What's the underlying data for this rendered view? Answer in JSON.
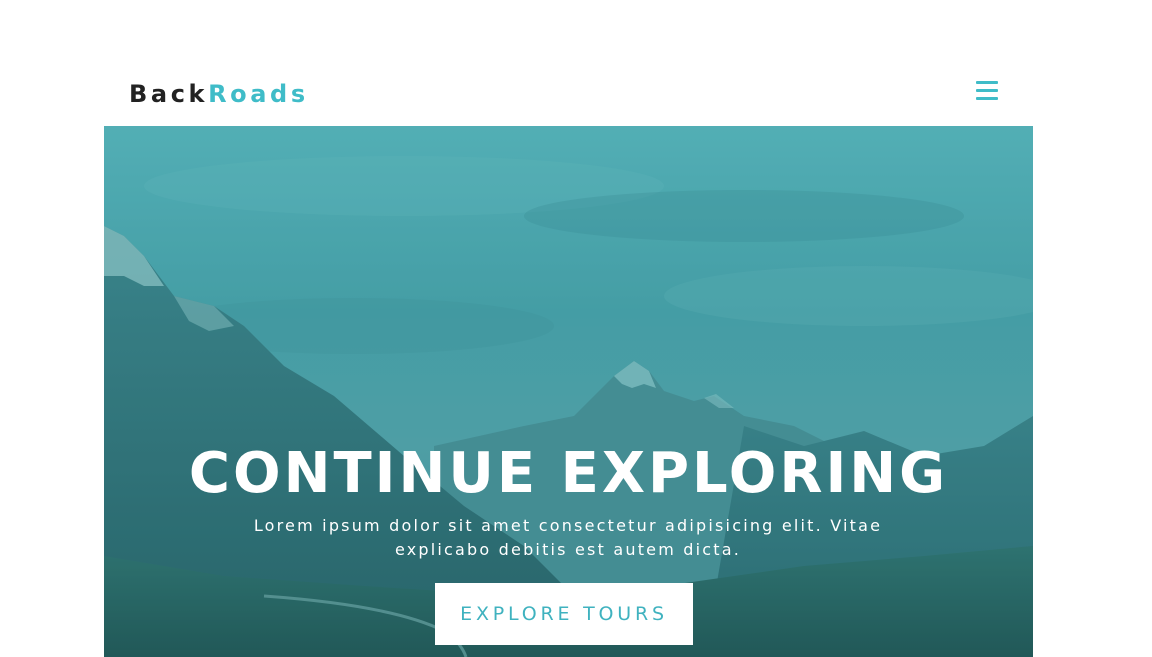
{
  "navbar": {
    "logo_part1": "Back",
    "logo_part2": "Roads",
    "menu_icon": "hamburger-menu-icon"
  },
  "hero": {
    "title": "CONTINUE EXPLORING",
    "text": "Lorem ipsum dolor sit amet consectetur adipisicing elit. Vitae explicabo debitis est autem dicta.",
    "button_label": "EXPLORE TOURS",
    "background": "mountain-landscape-image"
  },
  "colors": {
    "accent": "#3fbcc8",
    "dark_text": "#222222",
    "overlay": "#2a9aa3",
    "white": "#ffffff"
  }
}
